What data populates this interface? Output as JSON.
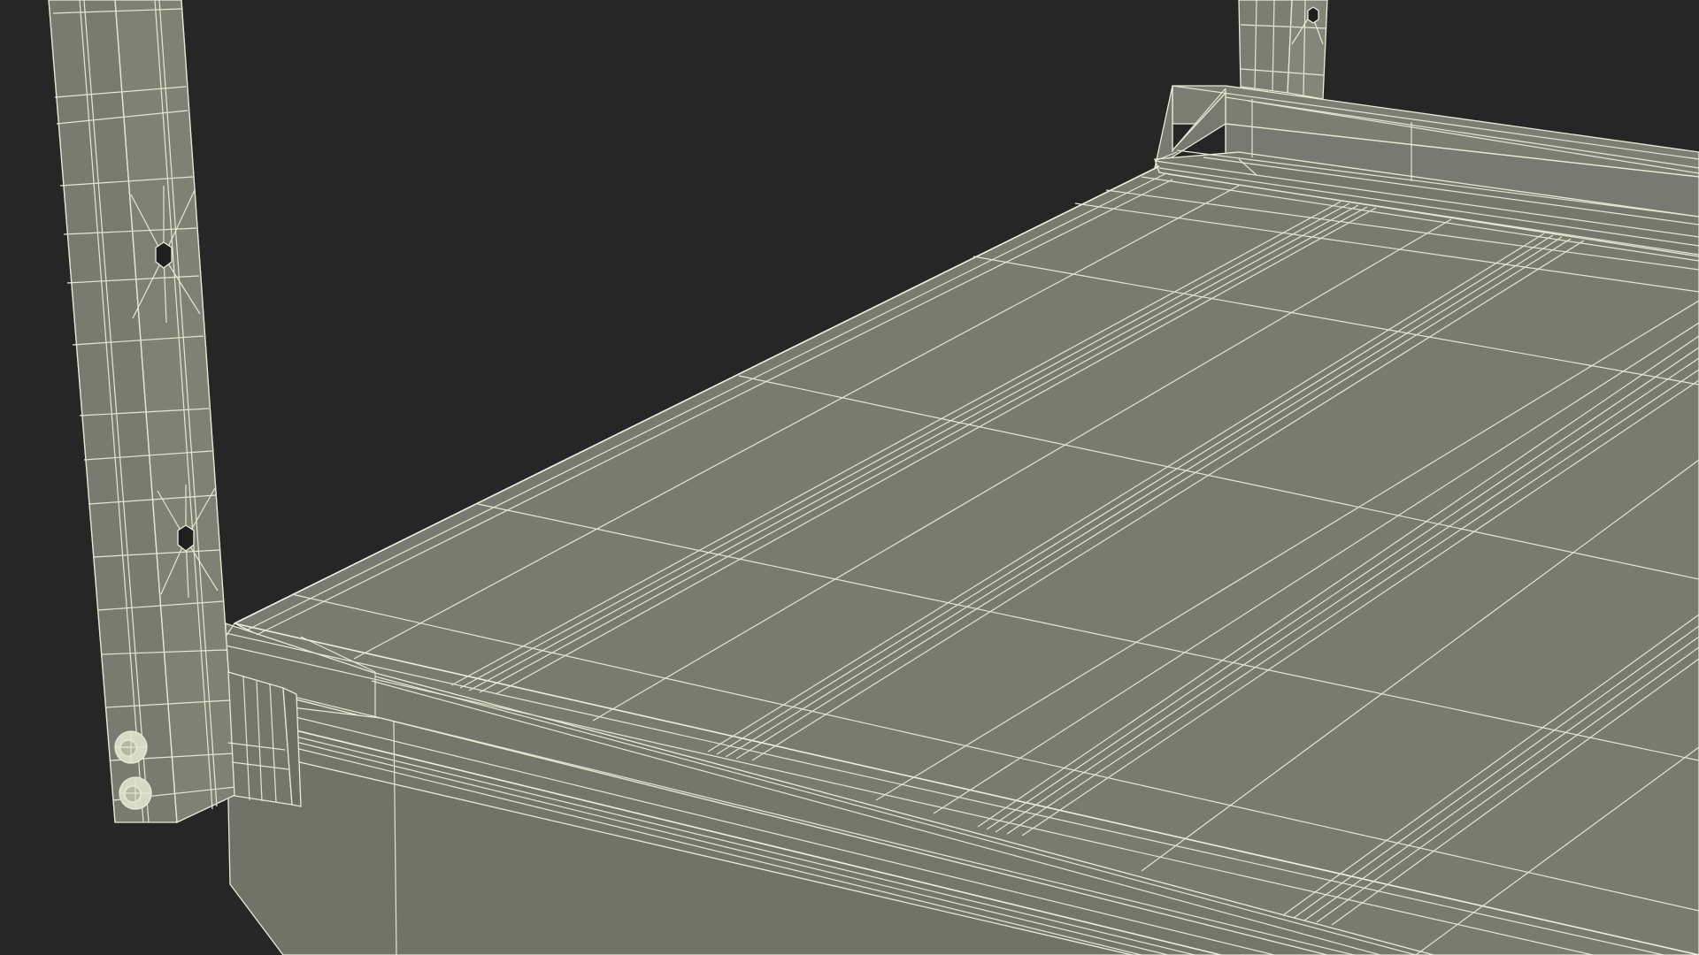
{
  "scene": {
    "description_visible_text": "",
    "colors": {
      "background": "#262626",
      "surface": "#7a7b70",
      "surface_dark": "#6f7065",
      "surface_light": "#87887c",
      "wire": "#e9ecd8",
      "hole": "#1f1f1f"
    }
  }
}
